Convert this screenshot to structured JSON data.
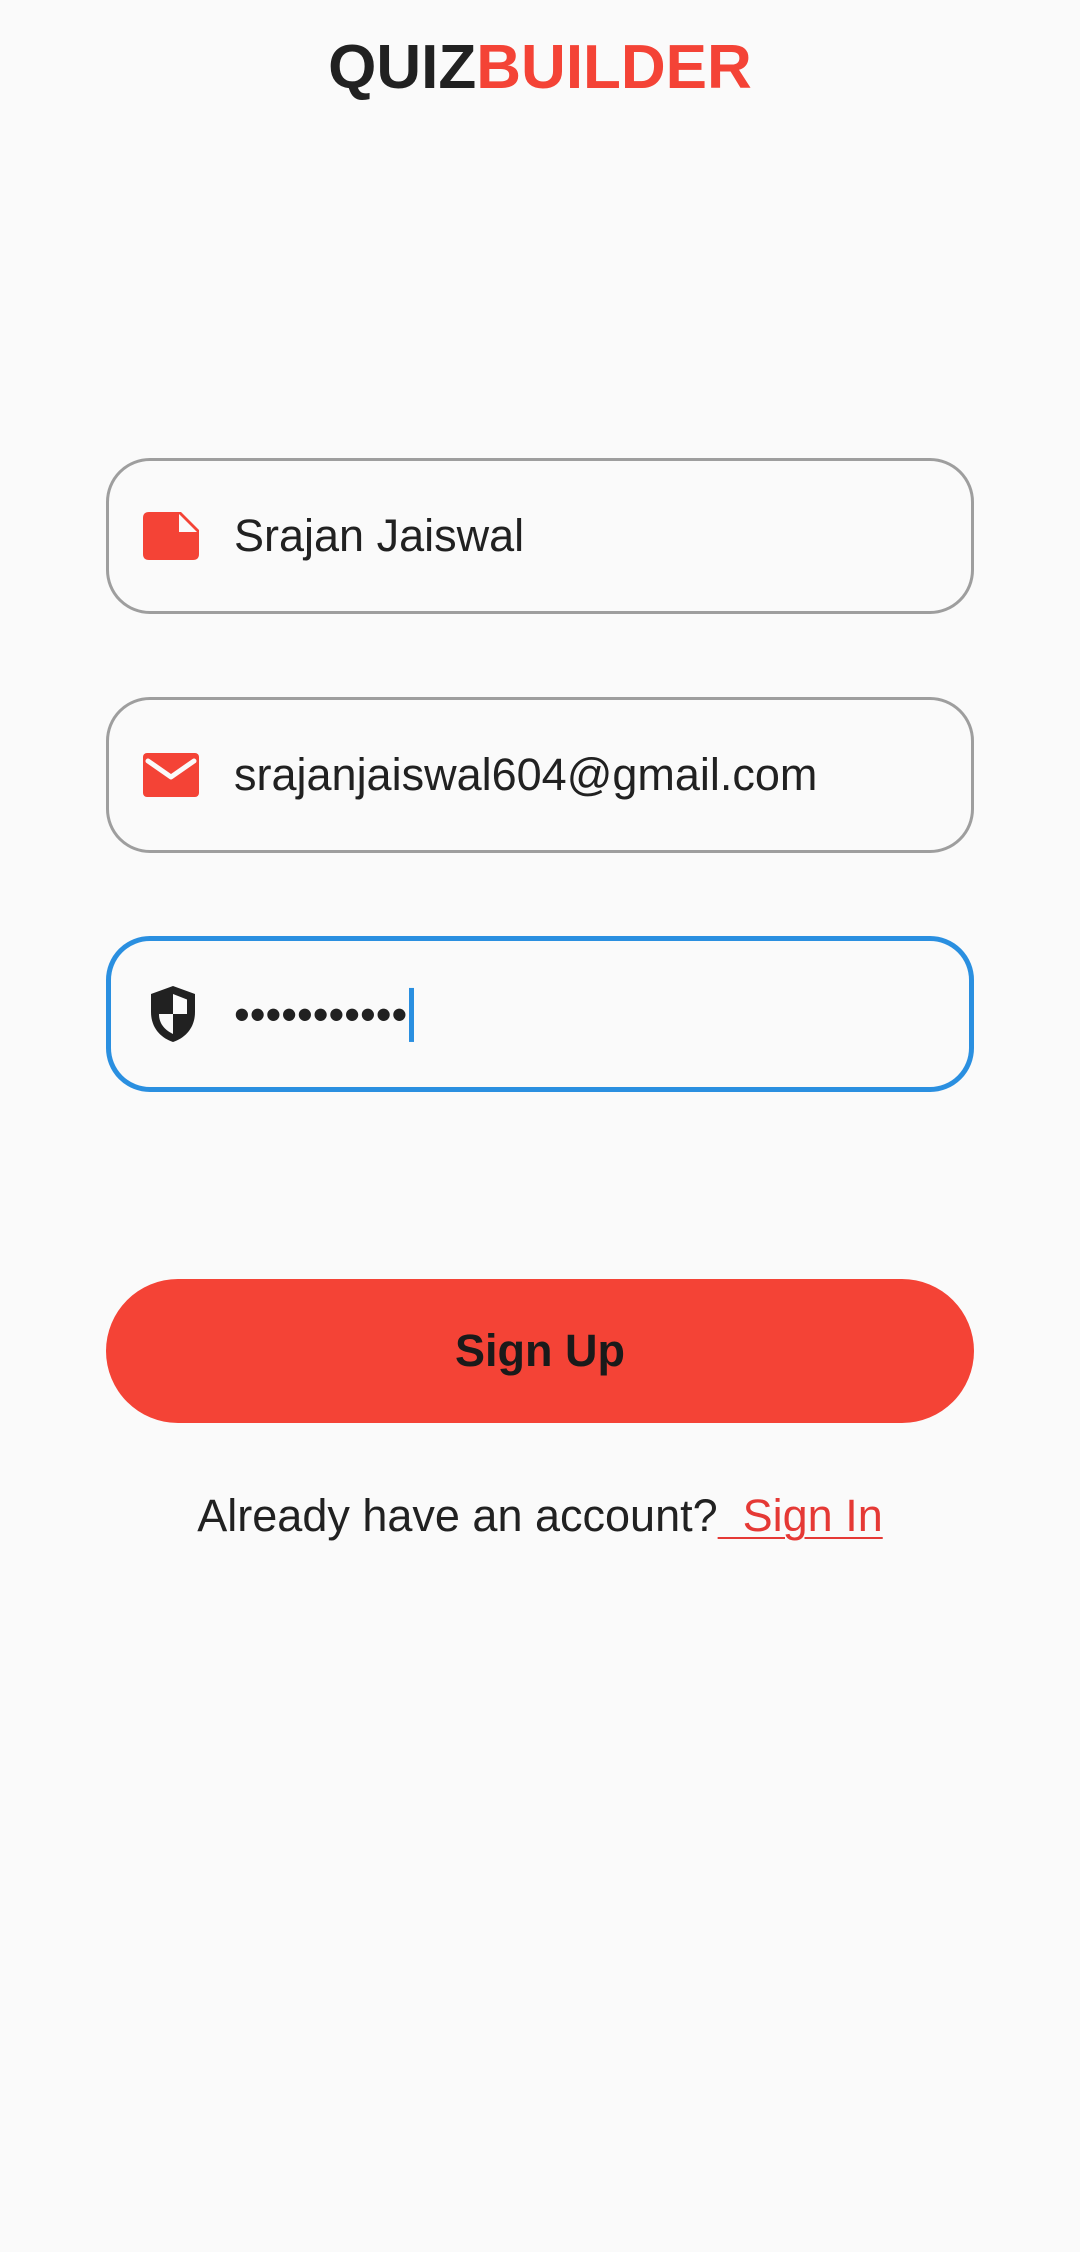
{
  "app": {
    "title_part1": "QUIZ",
    "title_part2": "BUILDER"
  },
  "form": {
    "name": {
      "value": "Srajan Jaiswal",
      "icon": "note-icon"
    },
    "email": {
      "value": "srajanjaiswal604@gmail.com",
      "icon": "mail-icon"
    },
    "password": {
      "value": "•••••••••••",
      "icon": "shield-icon",
      "focused": true
    }
  },
  "signup_button": {
    "label": "Sign Up"
  },
  "signin_prompt": {
    "text": "Already have an account?",
    "link_label": "  Sign In"
  },
  "colors": {
    "accent": "#f44336",
    "focus": "#2a8fe0",
    "text": "#212121",
    "background": "#fafafa",
    "border": "#9e9e9e"
  }
}
